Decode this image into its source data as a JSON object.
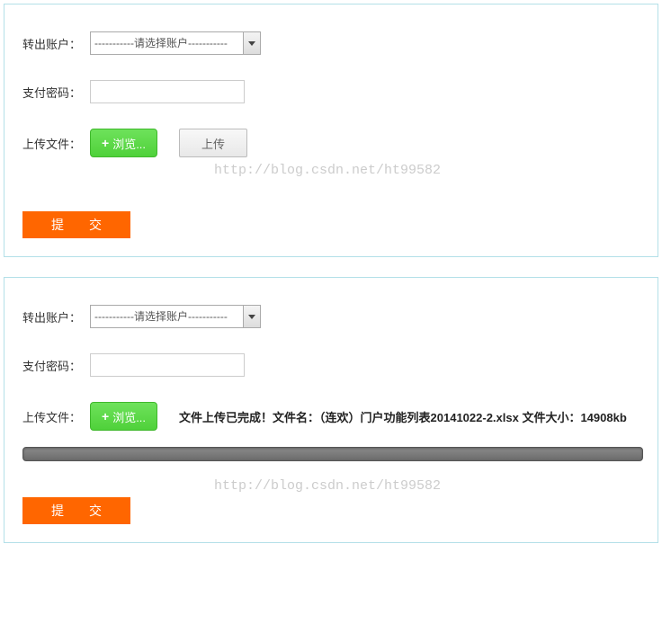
{
  "form1": {
    "account_label": "转出账户：",
    "account_placeholder": "-----------请选择账户-----------",
    "password_label": "支付密码：",
    "upload_label": "上传文件：",
    "browse_btn": "浏览...",
    "upload_btn": "上传",
    "submit_btn": "提交"
  },
  "form2": {
    "account_label": "转出账户：",
    "account_placeholder": "-----------请选择账户-----------",
    "password_label": "支付密码：",
    "upload_label": "上传文件：",
    "browse_btn": "浏览...",
    "upload_status": "文件上传已完成！文件名：（连欢）门户功能列表20141022-2.xlsx 文件大小：14908kb",
    "submit_btn": "提交"
  },
  "watermark": "http://blog.csdn.net/ht99582"
}
